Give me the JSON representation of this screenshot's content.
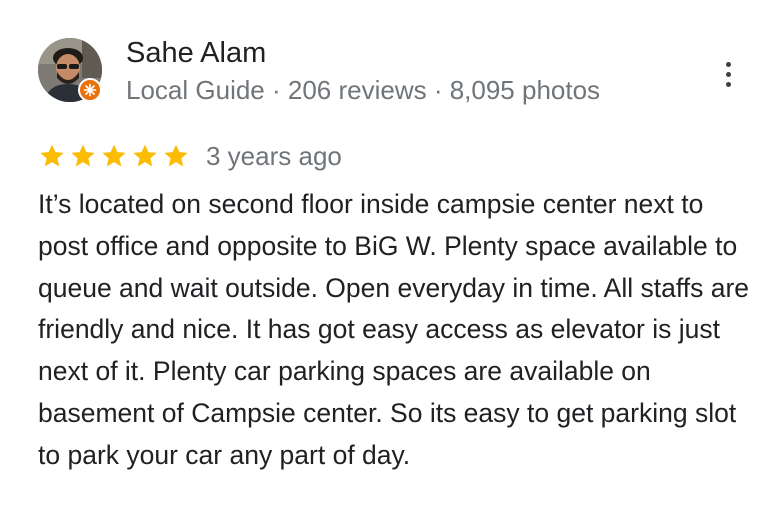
{
  "reviewer": {
    "name": "Sahe Alam",
    "meta": "Local Guide · 206 reviews · 8,095 photos",
    "avatar_icon": "profile-photo",
    "badge_icon": "local-guide-badge-icon",
    "badge_color": "#e8710a"
  },
  "rating": {
    "stars": 5,
    "max_stars": 5,
    "star_color": "#fbbc04",
    "date": "3 years ago"
  },
  "review_text": "It’s located on second floor inside campsie center next to post office and opposite to BiG W. Plenty space available to queue and wait outside. Open everyday in time. All staffs are friendly and nice. It has got easy access as elevator is just next of it. Plenty car parking spaces are available on basement of Campsie center. So its easy to get parking slot to park your car any part of day.",
  "menu": {
    "icon": "more-vert-icon"
  }
}
